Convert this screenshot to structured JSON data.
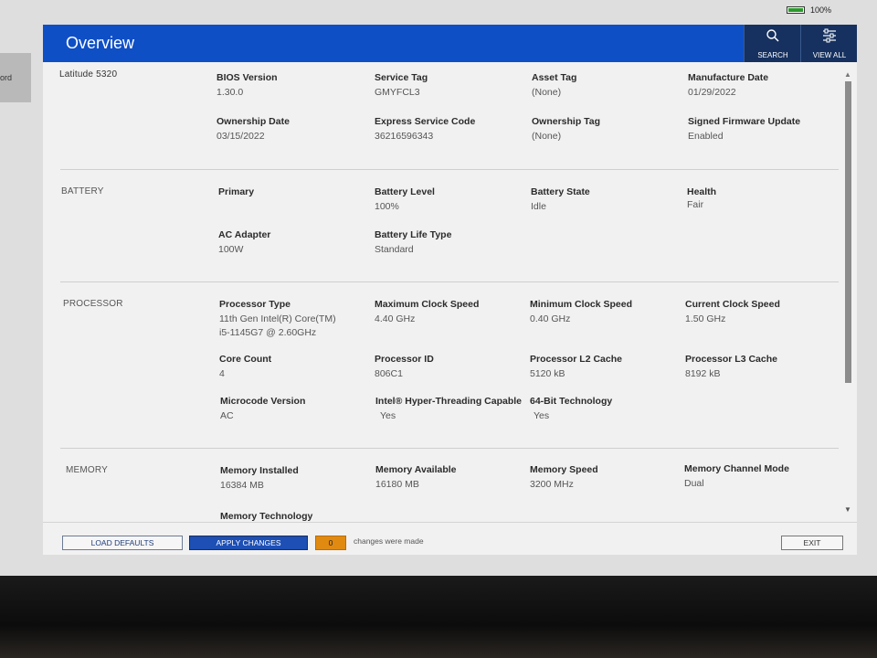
{
  "status": {
    "battery_percent": "100%"
  },
  "side_tab": {
    "label": "ord"
  },
  "header": {
    "title": "Overview",
    "search_label": "SEARCH",
    "view_all_label": "VIEW ALL"
  },
  "overview": {
    "model": "Latitude 5320",
    "fields": [
      {
        "label": "BIOS Version",
        "value": "1.30.0"
      },
      {
        "label": "Service Tag",
        "value": "GMYFCL3"
      },
      {
        "label": "Asset Tag",
        "value": "(None)"
      },
      {
        "label": "Manufacture Date",
        "value": "01/29/2022"
      },
      {
        "label": "Ownership Date",
        "value": "03/15/2022"
      },
      {
        "label": "Express Service Code",
        "value": "36216596343"
      },
      {
        "label": "Ownership Tag",
        "value": "(None)"
      },
      {
        "label": "Signed Firmware Update",
        "value": "Enabled"
      }
    ]
  },
  "battery": {
    "section": "BATTERY",
    "fields": [
      {
        "label": "Primary",
        "value": ""
      },
      {
        "label": "Battery Level",
        "value": "100%"
      },
      {
        "label": "Battery State",
        "value": "Idle"
      },
      {
        "label": "Health",
        "value": "Fair"
      },
      {
        "label": "AC Adapter",
        "value": "100W"
      },
      {
        "label": "Battery Life Type",
        "value": "Standard"
      }
    ]
  },
  "processor": {
    "section": "PROCESSOR",
    "fields": [
      {
        "label": "Processor Type",
        "value": "11th Gen Intel(R) Core(TM)",
        "value2": "i5-1145G7 @ 2.60GHz"
      },
      {
        "label": "Maximum Clock Speed",
        "value": "4.40 GHz"
      },
      {
        "label": "Minimum Clock Speed",
        "value": "0.40 GHz"
      },
      {
        "label": "Current Clock Speed",
        "value": "1.50 GHz"
      },
      {
        "label": "Core Count",
        "value": "4"
      },
      {
        "label": "Processor ID",
        "value": "806C1"
      },
      {
        "label": "Processor L2 Cache",
        "value": "5120 kB"
      },
      {
        "label": "Processor L3 Cache",
        "value": "8192 kB"
      },
      {
        "label": "Microcode Version",
        "value": "AC"
      },
      {
        "label": "Intel® Hyper-Threading Capable",
        "value": "Yes"
      },
      {
        "label": "64-Bit Technology",
        "value": "Yes"
      }
    ]
  },
  "memory": {
    "section": "MEMORY",
    "fields": [
      {
        "label": "Memory Installed",
        "value": "16384 MB"
      },
      {
        "label": "Memory Available",
        "value": "16180 MB"
      },
      {
        "label": "Memory Speed",
        "value": "3200 MHz"
      },
      {
        "label": "Memory Channel Mode",
        "value": "Dual"
      },
      {
        "label": "Memory Technology",
        "value": ""
      }
    ]
  },
  "footer": {
    "load_defaults": "LOAD DEFAULTS",
    "apply_changes": "APPLY CHANGES",
    "changes_count": "0",
    "changes_text": "changes were made",
    "exit": "EXIT"
  },
  "colors": {
    "header_blue": "#0f4fc6",
    "header_button": "#16315f",
    "apply_button": "#1d4fb5",
    "changes_badge": "#e08a12"
  }
}
